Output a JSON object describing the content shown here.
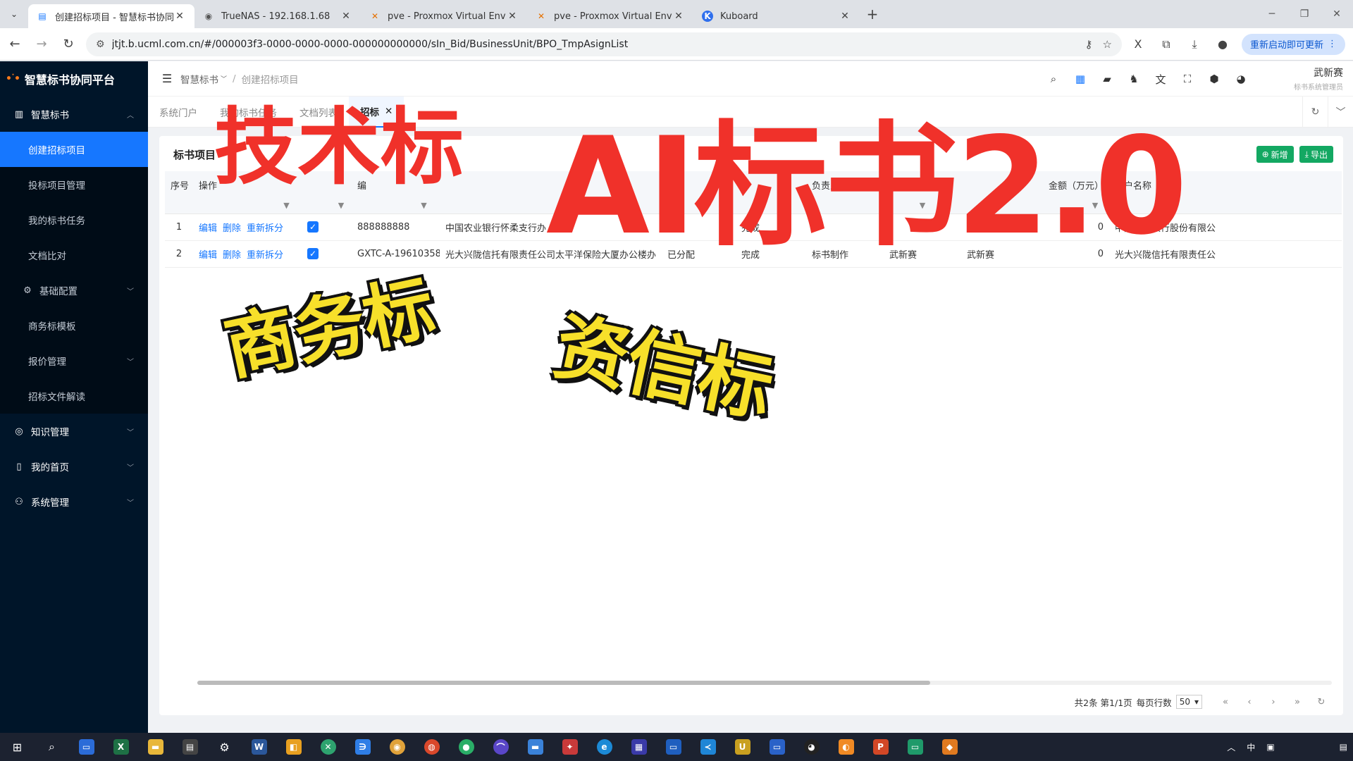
{
  "browser": {
    "tabs": [
      {
        "title": "创建招标项目 - 智慧标书协同平",
        "active": true,
        "icon": "document-icon"
      },
      {
        "title": "TrueNAS - 192.168.1.68",
        "active": false,
        "icon": "truenas-icon"
      },
      {
        "title": "pve - Proxmox Virtual Enviro",
        "active": false,
        "icon": "proxmox-icon"
      },
      {
        "title": "pve - Proxmox Virtual Enviro",
        "active": false,
        "icon": "proxmox-icon"
      },
      {
        "title": "Kuboard",
        "active": false,
        "icon": "kuboard-icon"
      }
    ],
    "url": "jtjt.b.ucml.com.cn/#/000003f3-0000-0000-0000-000000000000/sIn_Bid/BusinessUnit/BPO_TmpAsignList",
    "update_button": "重新启动即可更新"
  },
  "sidebar": {
    "brand": "智慧标书协同平台",
    "items": [
      {
        "label": "智慧标书",
        "level": "top",
        "open": true
      },
      {
        "label": "创建招标项目",
        "level": "sub",
        "active": true
      },
      {
        "label": "投标项目管理",
        "level": "sub"
      },
      {
        "label": "我的标书任务",
        "level": "sub"
      },
      {
        "label": "文档比对",
        "level": "sub"
      },
      {
        "label": "基础配置",
        "level": "top"
      },
      {
        "label": "商务标模板",
        "level": "sub"
      },
      {
        "label": "报价管理",
        "level": "sub"
      },
      {
        "label": "招标文件解读",
        "level": "sub"
      },
      {
        "label": "知识管理",
        "level": "top"
      },
      {
        "label": "我的首页",
        "level": "top"
      },
      {
        "label": "系统管理",
        "level": "top"
      }
    ]
  },
  "header": {
    "breadcrumb": [
      "智慧标书",
      "创建招标项目"
    ],
    "user_name": "武新赛",
    "user_role": "标书系统管理员"
  },
  "tags": [
    "系统门户",
    "我的标书任务",
    "文档列表",
    "招标"
  ],
  "card": {
    "title": "标书项目",
    "add_button": "新增",
    "export_button": "导出"
  },
  "table": {
    "columns": [
      "序号",
      "操作",
      "",
      "",
      "编",
      "",
      "",
      "",
      "负责人",
      "制作",
      "",
      "金额（万元）",
      "客户名称"
    ],
    "rows": [
      {
        "index": "1",
        "ops": [
          "编辑",
          "删除",
          "重新拆分"
        ],
        "checked": true,
        "code": "888888888",
        "name": "中国农业银行怀柔支行办",
        "c6": "目",
        "status": "完成",
        "c8": "",
        "owner": "",
        "maker": "",
        "amount": "0",
        "customer": "中国农业银行股份有限公"
      },
      {
        "index": "2",
        "ops": [
          "编辑",
          "删除",
          "重新拆分"
        ],
        "checked": true,
        "code": "GXTC-A-19610358",
        "name": "光大兴陇信托有限责任公司太平洋保险大厦办公楼办",
        "c6": "已分配",
        "status": "完成",
        "c8": "标书制作",
        "owner": "武新赛",
        "maker": "武新赛",
        "amount": "0",
        "customer": "光大兴陇信托有限责任公"
      }
    ]
  },
  "pager": {
    "summary": "共2条 第1/1页",
    "page_size_label": "每页行数",
    "page_size": "50"
  },
  "overlay": {
    "tech": "技术标",
    "ai": "AI标书2.0",
    "business": "商务标",
    "credit": "资信标"
  },
  "taskbar": {
    "apps": [
      "windows-icon",
      "search-icon",
      "task-view-icon",
      "excel-icon",
      "folder-icon",
      "app-icon",
      "settings-icon",
      "word-icon",
      "app-icon",
      "xmind-icon",
      "app-icon",
      "chrome-icon",
      "app-icon",
      "wechat-icon",
      "app-icon",
      "app-icon",
      "app-icon",
      "edge-icon",
      "app-icon",
      "app-icon",
      "vscode-icon",
      "app-icon",
      "app-icon",
      "qq-icon",
      "app-icon",
      "powerpoint-icon",
      "app-icon",
      "app-icon"
    ],
    "ime": "中"
  }
}
